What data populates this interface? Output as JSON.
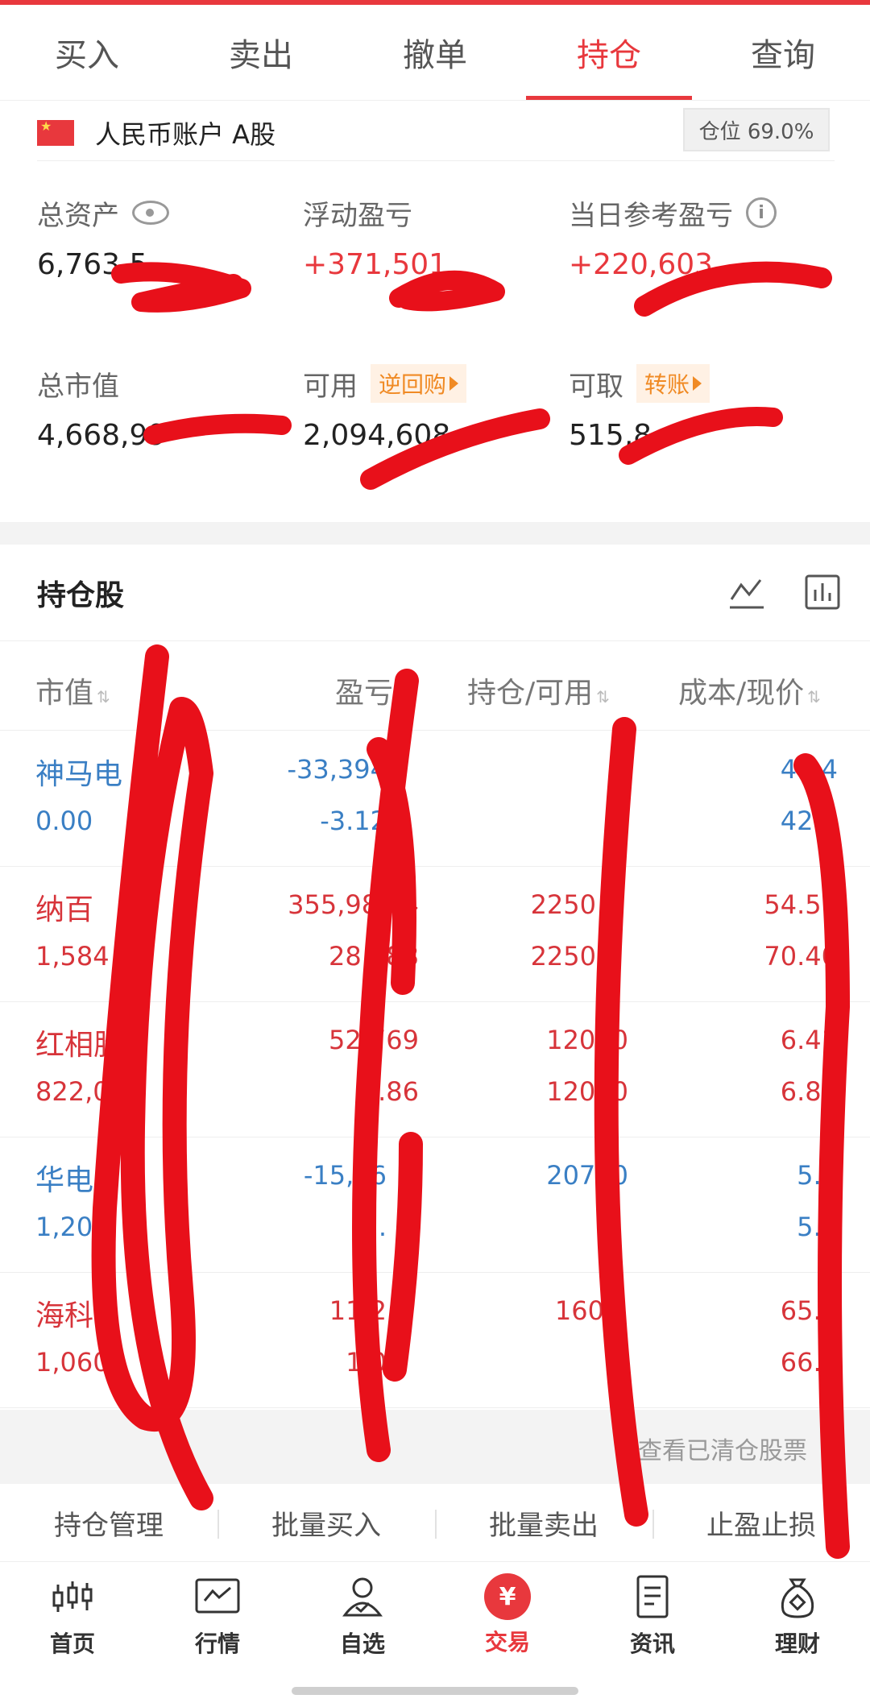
{
  "tabs": [
    "买入",
    "卖出",
    "撤单",
    "持仓",
    "查询"
  ],
  "active_tab": "持仓",
  "account": {
    "name": "人民币账户 A股",
    "position_ratio": "仓位 69.0%"
  },
  "summary": {
    "total_assets_label": "总资产",
    "total_assets": "6,763,5",
    "floating_pl_label": "浮动盈亏",
    "floating_pl": "+371,501",
    "daily_pl_label": "当日参考盈亏",
    "daily_pl": "+220,603",
    "market_value_label": "总市值",
    "market_value": "4,668,99",
    "available_label": "可用",
    "available_tag": "逆回购",
    "available": "2,094,608",
    "withdrawable_label": "可取",
    "withdrawable_tag": "转账",
    "withdrawable": "515,8"
  },
  "holdings": {
    "title": "持仓股",
    "columns": [
      "市值",
      "盈亏",
      "持仓/可用",
      "成本/现价"
    ],
    "rows": [
      {
        "name": "神马电",
        "mv": "0.00",
        "pl": "-33,394",
        "pl_pct": "-3.12",
        "qty": "",
        "avail": "",
        "cost": "44.4",
        "price": "42.1",
        "color": "blue"
      },
      {
        "name": "纳百",
        "mv": "1,584",
        "pl": "355,983.4",
        "pl_pct": "28.988",
        "qty": "2250",
        "avail": "2250",
        "cost": "54.57",
        "price": "70.40",
        "color": "red"
      },
      {
        "name": "红相股",
        "mv": "822,0",
        "pl": "52,769",
        "pl_pct": "6.86",
        "qty": "12000",
        "avail": "12000",
        "cost": "6.41",
        "price": "6.85",
        "color": "red"
      },
      {
        "name": "华电",
        "mv": "1,20",
        "pl": "-15,06",
        "pl_pct": "-1.",
        "qty": "20700",
        "avail": "",
        "cost": "5.8",
        "price": "5.8",
        "color": "blue"
      },
      {
        "name": "海科",
        "mv": "1,060",
        "pl": "11,2",
        "pl_pct": "1.0",
        "qty": "160",
        "avail": "",
        "cost": "65.5",
        "price": "66.2",
        "color": "red"
      }
    ],
    "cleared_link": "查看已清仓股票"
  },
  "tools": [
    "持仓管理",
    "批量买入",
    "批量卖出",
    "止盈止损"
  ],
  "nav": [
    {
      "label": "首页",
      "icon": "candlestick-icon"
    },
    {
      "label": "行情",
      "icon": "chart-monitor-icon"
    },
    {
      "label": "自选",
      "icon": "user-check-icon"
    },
    {
      "label": "交易",
      "icon": "yuan-icon"
    },
    {
      "label": "资讯",
      "icon": "news-icon"
    },
    {
      "label": "理财",
      "icon": "money-bag-icon"
    }
  ],
  "colors": {
    "accent": "#e8383d",
    "down": "#3a7fc4",
    "tag": "#f08a24"
  }
}
